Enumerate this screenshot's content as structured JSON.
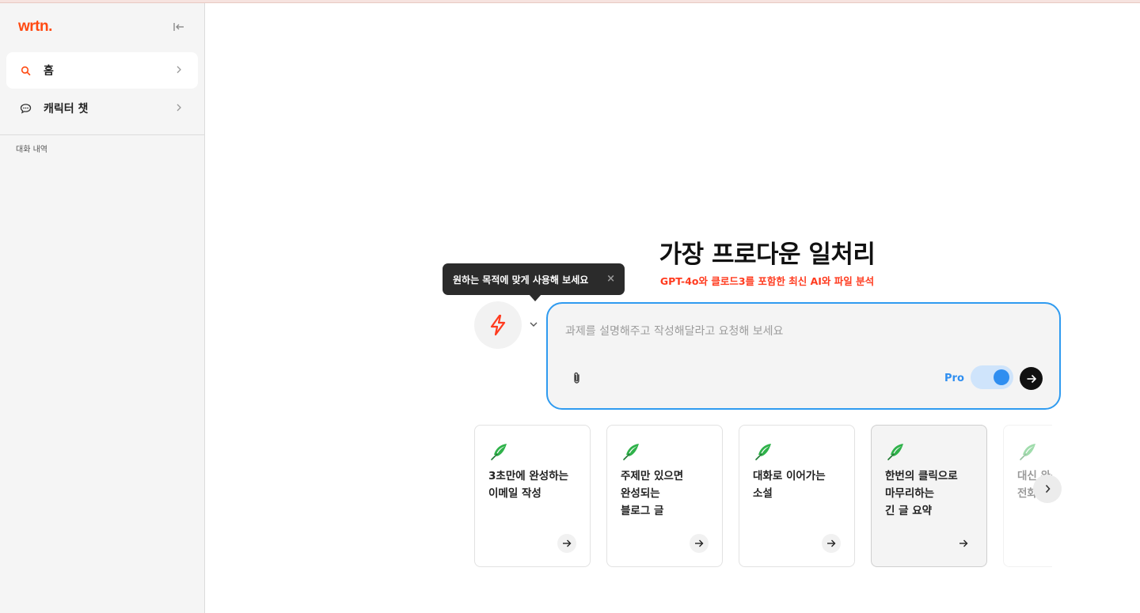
{
  "brand": {
    "logo": "wrtn.",
    "accent": "#ff4a12"
  },
  "sidebar": {
    "items": [
      {
        "label": "홈",
        "icon": "search-icon",
        "active": true
      },
      {
        "label": "캐릭터 챗",
        "icon": "chat-bubble-icon",
        "active": false
      }
    ],
    "history_label": "대화 내역"
  },
  "hero": {
    "title": "가장 프로다운 일처리",
    "subtitle": "GPT-4o와 클로드3를 포함한 최신 AI와 파일 분석"
  },
  "tooltip": {
    "text": "원하는 목적에 맞게 사용해 보세요",
    "close": "×"
  },
  "prompt": {
    "placeholder": "과제를 설명해주고 작성해달라고 요청해 보세요",
    "value": "",
    "pro_label": "Pro",
    "pro_enabled": true
  },
  "cards": [
    {
      "text": "3초만에 완성하는\n이메일 작성",
      "icon": "quill-icon"
    },
    {
      "text": "주제만 있으면\n완성되는\n블로그 글",
      "icon": "quill-icon"
    },
    {
      "text": "대화로 이어가는\n소설",
      "icon": "quill-icon"
    },
    {
      "text": "한번의 클릭으로\n마무리하는\n긴 글 요약",
      "icon": "quill-icon"
    },
    {
      "text": "대신 완성\n전화",
      "icon": "quill-icon"
    }
  ]
}
